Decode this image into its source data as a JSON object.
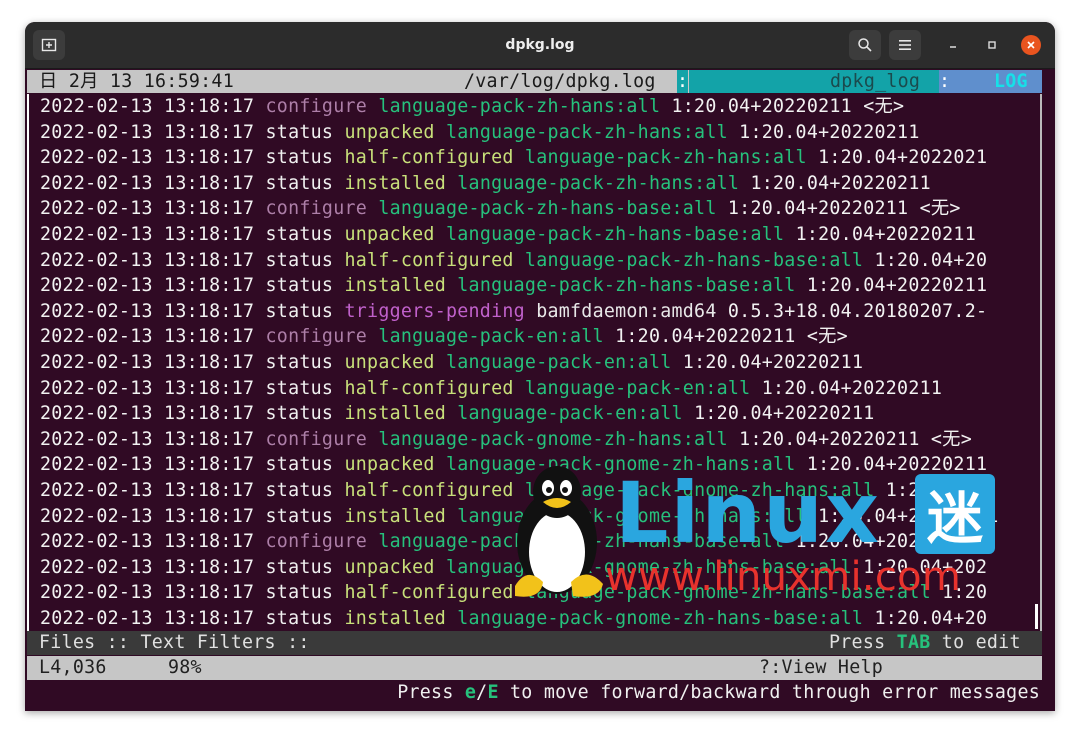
{
  "window": {
    "title": "dpkg.log"
  },
  "top_status": {
    "datetime": "日 2月 13 16:59:41",
    "path": "/var/log/dpkg.log",
    "separator": ":",
    "view": "dpkg_log",
    "mode": "LOG"
  },
  "log_lines": [
    {
      "ts": "2022-02-13 13:18:17",
      "action": "configure",
      "state": "",
      "pkg": "language-pack-zh-hans:all",
      "ver": "1:20.04+20220211 <无>"
    },
    {
      "ts": "2022-02-13 13:18:17",
      "action": "status",
      "state": "unpacked",
      "pkg": "language-pack-zh-hans:all",
      "ver": "1:20.04+20220211"
    },
    {
      "ts": "2022-02-13 13:18:17",
      "action": "status",
      "state": "half-configured",
      "pkg": "language-pack-zh-hans:all",
      "ver": "1:20.04+2022021"
    },
    {
      "ts": "2022-02-13 13:18:17",
      "action": "status",
      "state": "installed",
      "pkg": "language-pack-zh-hans:all",
      "ver": "1:20.04+20220211"
    },
    {
      "ts": "2022-02-13 13:18:17",
      "action": "configure",
      "state": "",
      "pkg": "language-pack-zh-hans-base:all",
      "ver": "1:20.04+20220211 <无>"
    },
    {
      "ts": "2022-02-13 13:18:17",
      "action": "status",
      "state": "unpacked",
      "pkg": "language-pack-zh-hans-base:all",
      "ver": "1:20.04+20220211"
    },
    {
      "ts": "2022-02-13 13:18:17",
      "action": "status",
      "state": "half-configured",
      "pkg": "language-pack-zh-hans-base:all",
      "ver": "1:20.04+20"
    },
    {
      "ts": "2022-02-13 13:18:17",
      "action": "status",
      "state": "installed",
      "pkg": "language-pack-zh-hans-base:all",
      "ver": "1:20.04+20220211"
    },
    {
      "ts": "2022-02-13 13:18:17",
      "action": "status",
      "state": "triggers-pending",
      "pkg": "bamfdaemon:amd64",
      "ver": "0.5.3+18.04.20180207.2-"
    },
    {
      "ts": "2022-02-13 13:18:17",
      "action": "configure",
      "state": "",
      "pkg": "language-pack-en:all",
      "ver": "1:20.04+20220211 <无>"
    },
    {
      "ts": "2022-02-13 13:18:17",
      "action": "status",
      "state": "unpacked",
      "pkg": "language-pack-en:all",
      "ver": "1:20.04+20220211"
    },
    {
      "ts": "2022-02-13 13:18:17",
      "action": "status",
      "state": "half-configured",
      "pkg": "language-pack-en:all",
      "ver": "1:20.04+20220211"
    },
    {
      "ts": "2022-02-13 13:18:17",
      "action": "status",
      "state": "installed",
      "pkg": "language-pack-en:all",
      "ver": "1:20.04+20220211"
    },
    {
      "ts": "2022-02-13 13:18:17",
      "action": "configure",
      "state": "",
      "pkg": "language-pack-gnome-zh-hans:all",
      "ver": "1:20.04+20220211 <无>"
    },
    {
      "ts": "2022-02-13 13:18:17",
      "action": "status",
      "state": "unpacked",
      "pkg": "language-pack-gnome-zh-hans:all",
      "ver": "1:20.04+20220211"
    },
    {
      "ts": "2022-02-13 13:18:17",
      "action": "status",
      "state": "half-configured",
      "pkg": "language-pack-gnome-zh-hans:all",
      "ver": "1:20.04+2"
    },
    {
      "ts": "2022-02-13 13:18:17",
      "action": "status",
      "state": "installed",
      "pkg": "language-pack-gnome-zh-hans:all",
      "ver": "1:20.04+20220211"
    },
    {
      "ts": "2022-02-13 13:18:17",
      "action": "configure",
      "state": "",
      "pkg": "language-pack-gnome-zh-hans-base:all",
      "ver": "1:20.04+20220211"
    },
    {
      "ts": "2022-02-13 13:18:17",
      "action": "status",
      "state": "unpacked",
      "pkg": "language-pack-gnome-zh-hans-base:all",
      "ver": "1:20.04+202"
    },
    {
      "ts": "2022-02-13 13:18:17",
      "action": "status",
      "state": "half-configured",
      "pkg": "language-pack-gnome-zh-hans-base:all",
      "ver": "1:20"
    },
    {
      "ts": "2022-02-13 13:18:17",
      "action": "status",
      "state": "installed",
      "pkg": "language-pack-gnome-zh-hans-base:all",
      "ver": "1:20.04+20"
    }
  ],
  "bottom_bar": {
    "left": "Files :: Text Filters ::",
    "press": "Press ",
    "tab_key": "TAB",
    "to_edit": " to edit"
  },
  "status_bar": {
    "line": "L4,036",
    "percent": "98%",
    "help": "?:View Help"
  },
  "help_line": {
    "press": "Press ",
    "key1": "e",
    "slash": "/",
    "key2": "E",
    "rest": " to move forward/backward through error messages"
  },
  "watermark": {
    "brand": "Linux",
    "char": "迷",
    "url": "www.linuxmi.com"
  },
  "colors": {
    "terminal_bg": "#300a24",
    "package": "#26c17c",
    "state": "#c8e07a",
    "configure": "#ad7fa8",
    "triggers": "#c061cb",
    "mode_bar": "#13a3a8",
    "close_button": "#e9541f"
  }
}
